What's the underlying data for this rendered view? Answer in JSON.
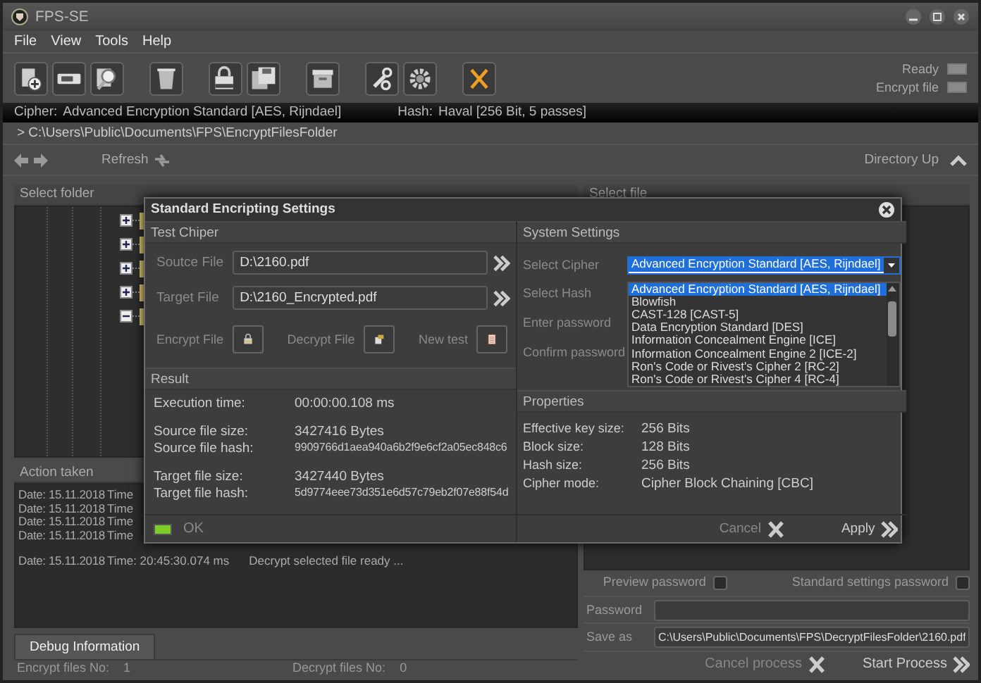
{
  "window": {
    "title": "FPS-SE"
  },
  "menu": [
    "File",
    "View",
    "Tools",
    "Help"
  ],
  "indicators": [
    {
      "label": "Ready",
      "on": false
    },
    {
      "label": "Encrypt file",
      "on": false
    }
  ],
  "cipher_bar": {
    "cipher_label": "Cipher:",
    "cipher": "Advanced Encryption Standard [AES, Rijndael]",
    "hash_label": "Hash:",
    "hash": "Haval [256 Bit, 5 passes]"
  },
  "path": "> C:\\Users\\Public\\Documents\\FPS\\EncryptFilesFolder",
  "nav": {
    "refresh": "Refresh",
    "directory_up": "Directory Up"
  },
  "left_header": "Select folder",
  "right_header": "Select file",
  "tree_nodes": [
    {
      "expanded": false
    },
    {
      "expanded": false
    },
    {
      "expanded": false
    },
    {
      "expanded": false
    },
    {
      "expanded": true
    }
  ],
  "action_log": {
    "title": "Action taken",
    "groups": [
      [
        {
          "date": "Date: 15.11.2018",
          "time": "Time"
        },
        {
          "date": "Date: 15.11.2018",
          "time": "Time"
        },
        {
          "date": "Date: 15.11.2018",
          "time": "Time"
        },
        {
          "date": "Date: 15.11.2018",
          "time": "Time"
        }
      ],
      [
        {
          "date": "Date: 15.11.2018",
          "time": "Time: 20:45:30.074 ms",
          "message": "Decrypt selected file ready ..."
        }
      ]
    ]
  },
  "tabs": [
    {
      "label": "Debug Information",
      "selected": true
    }
  ],
  "status": [
    {
      "label": "Encrypt files No:",
      "value": "1"
    },
    {
      "label": "Decrypt files No:",
      "value": "0"
    }
  ],
  "options": [
    {
      "label": "Preview password",
      "checked": false
    },
    {
      "label": "Standard settings password",
      "checked": false
    }
  ],
  "password": {
    "label": "Password"
  },
  "save_as": {
    "label": "Save as",
    "value": "C:\\Users\\Public\\Documents\\FPS\\DecryptFilesFolder\\2160.pdf"
  },
  "actions": [
    {
      "label": "Cancel process",
      "kind": "cancel"
    },
    {
      "label": "Start Process",
      "kind": "start"
    }
  ],
  "dialog": {
    "title": "Standard Encripting Settings",
    "test": {
      "title": "Test Chiper",
      "fields": [
        {
          "label": "Soutce File",
          "value": "D:\\2160.pdf"
        },
        {
          "label": "Target File",
          "value": "D:\\2160_Encrypted.pdf"
        }
      ],
      "buttons": [
        {
          "label": "Encrypt File",
          "kind": "lock"
        },
        {
          "label": "Decrypt File",
          "kind": "doc"
        },
        {
          "label": "New test",
          "kind": "list"
        }
      ]
    },
    "result": {
      "title": "Result",
      "groups": [
        [
          {
            "label": "Execution time:",
            "value": "00:00:00.108 ms"
          }
        ],
        [
          {
            "label": "Source file size:",
            "value": "3427416 Bytes"
          },
          {
            "label": "Source file hash:",
            "value": "9909766d1aea940a6b2f9e6cf2a05ec848c6"
          }
        ],
        [
          {
            "label": "Target file size:",
            "value": "3427440 Bytes"
          },
          {
            "label": "Target file hash:",
            "value": "5d9774eee73d351e6d57c79eb2f07e88f54d"
          }
        ]
      ]
    },
    "status": {
      "label": "OK",
      "on": true
    },
    "system": {
      "title": "System Settings",
      "cipher": {
        "label": "Select Cipher",
        "value": "Advanced Encryption Standard [AES, Rijndael]",
        "expanded": true,
        "options": [
          {
            "label": "Advanced Encryption Standard [AES, Rijndael]",
            "selected": true
          },
          {
            "label": "Blowfish",
            "selected": false
          },
          {
            "label": "CAST-128 [CAST-5]",
            "selected": false
          },
          {
            "label": "Data Encryption Standard [DES]",
            "selected": false
          },
          {
            "label": "Information Concealment Engine [ICE]",
            "selected": false
          },
          {
            "label": "Information Concealment Engine 2 [ICE-2]",
            "selected": false
          },
          {
            "label": "Ron's Code or Rivest's Cipher 2 [RC-2]",
            "selected": false
          },
          {
            "label": "Ron's Code or Rivest's Cipher 4 [RC-4]",
            "selected": false
          }
        ]
      },
      "labels": [
        "Select Hash",
        "Enter password",
        "Confirm password"
      ]
    },
    "properties": {
      "title": "Properties",
      "rows": [
        {
          "label": "Effective key size:",
          "value": "256 Bits"
        },
        {
          "label": "Block size:",
          "value": "128 Bits"
        },
        {
          "label": "Hash size:",
          "value": "256 Bits"
        },
        {
          "label": "Cipher mode:",
          "value": "Cipher Block Chaining [CBC]"
        }
      ]
    },
    "buttons": [
      {
        "label": "Cancel",
        "kind": "cancel"
      },
      {
        "label": "Apply",
        "kind": "apply"
      }
    ]
  }
}
